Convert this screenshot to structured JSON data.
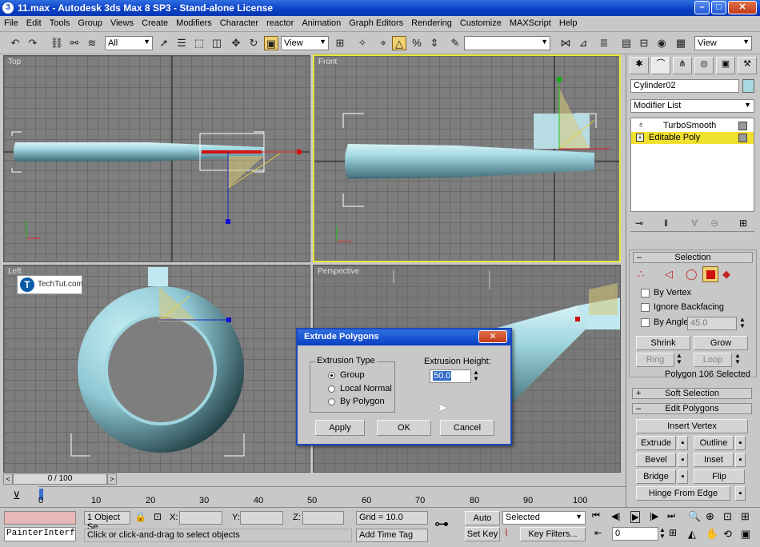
{
  "window": {
    "title": "11.max - Autodesk 3ds Max 8 SP3 - Stand-alone License",
    "min": "–",
    "max": "□",
    "close": "✕"
  },
  "menu": [
    "File",
    "Edit",
    "Tools",
    "Group",
    "Views",
    "Create",
    "Modifiers",
    "Character",
    "reactor",
    "Animation",
    "Graph Editors",
    "Rendering",
    "Customize",
    "MAXScript",
    "Help"
  ],
  "toolbar": {
    "selection_filter": "All",
    "ref_coord": "View",
    "named_sel": "",
    "view2": "View"
  },
  "viewports": {
    "top": "Top",
    "front": "Front",
    "left": "Left",
    "perspective": "Perspective"
  },
  "watermark": {
    "logo": "T",
    "text": "TechTut.com"
  },
  "command_panel": {
    "object_name": "Cylinder02",
    "object_color": "#a8d8e0",
    "modifier_list": "Modifier List",
    "stack": [
      {
        "label": "TurboSmooth",
        "selected": false
      },
      {
        "label": "Editable Poly",
        "selected": true
      }
    ],
    "selection": {
      "header": "Selection",
      "by_vertex": "By Vertex",
      "ignore_backfacing": "Ignore Backfacing",
      "by_angle": "By Angle:",
      "angle_value": "45.0",
      "shrink": "Shrink",
      "grow": "Grow",
      "ring": "Ring",
      "loop": "Loop",
      "status": "Polygon 106 Selected"
    },
    "soft_selection": "Soft Selection",
    "edit_polygons": {
      "header": "Edit Polygons",
      "insert_vertex": "Insert Vertex",
      "extrude": "Extrude",
      "outline": "Outline",
      "bevel": "Bevel",
      "inset": "Inset",
      "bridge": "Bridge",
      "flip": "Flip",
      "hinge": "Hinge From Edge"
    }
  },
  "dialog": {
    "title": "Extrude Polygons",
    "close": "✕",
    "group_label": "Extrusion Type",
    "options": [
      {
        "label": "Group",
        "checked": true
      },
      {
        "label": "Local Normal",
        "checked": false
      },
      {
        "label": "By Polygon",
        "checked": false
      }
    ],
    "height_label": "Extrusion Height:",
    "height_value": "50.0",
    "apply": "Apply",
    "ok": "OK",
    "cancel": "Cancel"
  },
  "timeline": {
    "slider": "0 / 100",
    "ticks": [
      "0",
      "10",
      "20",
      "30",
      "40",
      "50",
      "60",
      "70",
      "80",
      "90",
      "100"
    ]
  },
  "status": {
    "script": "PainterInterf",
    "selected": "1 Object Se",
    "x_label": "X:",
    "y_label": "Y:",
    "z_label": "Z:",
    "grid": "Grid = 10.0",
    "prompt": "Click or click-and-drag to select objects",
    "add_time_tag": "Add Time Tag",
    "auto_key": "Auto Key",
    "set_key": "Set Key",
    "selected_dd": "Selected",
    "key_filters": "Key Filters...",
    "frame": "0"
  },
  "colors": {
    "viewport_bg": "#7e7e7e",
    "mesh": "#9fd6e0",
    "active_border": "#e8e83a",
    "title_blue": "#0a3fc4"
  }
}
